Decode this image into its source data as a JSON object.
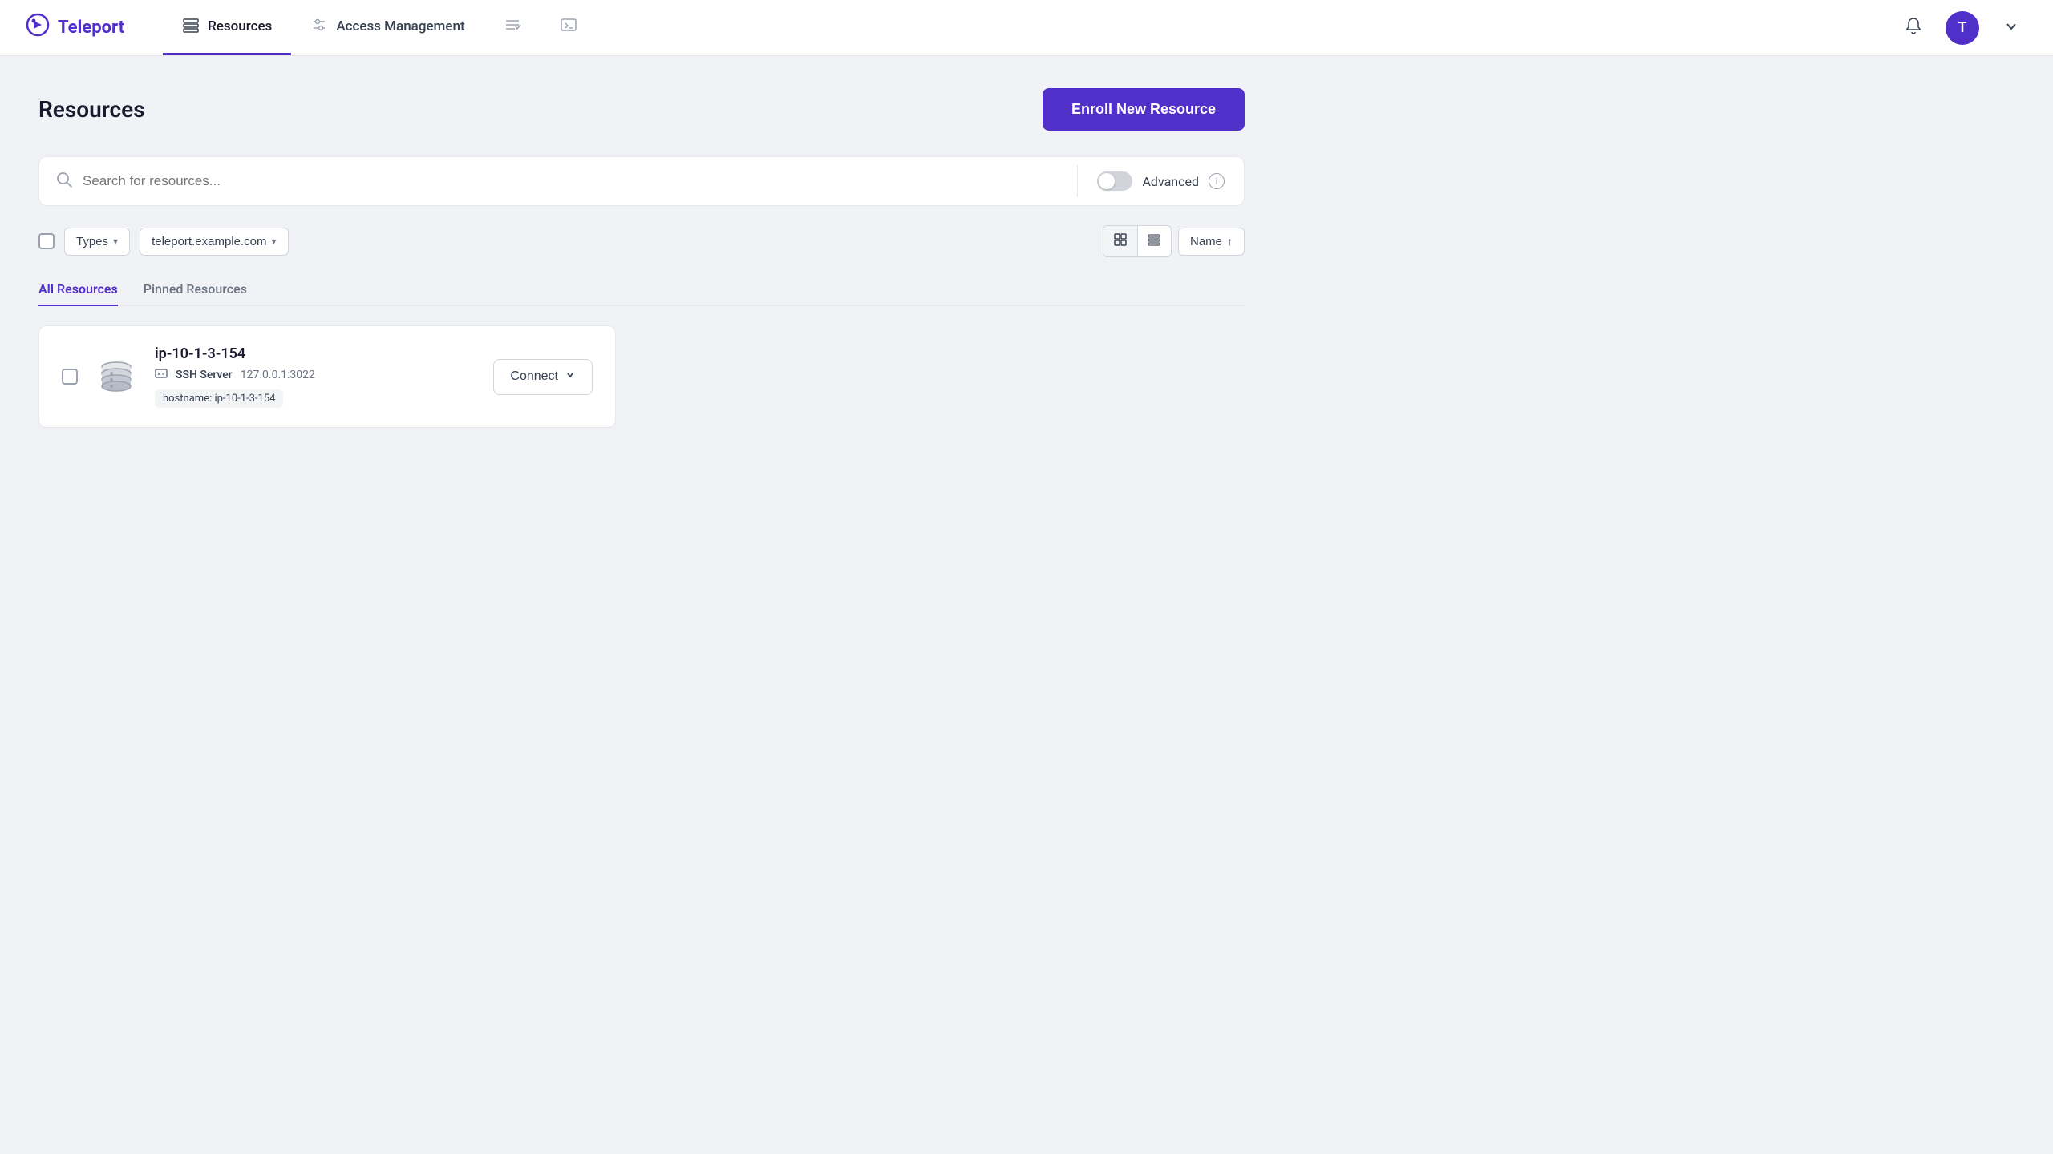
{
  "brand": {
    "name": "Teleport",
    "logo_icon": "⚙",
    "avatar_letter": "T"
  },
  "nav": {
    "items": [
      {
        "id": "resources",
        "label": "Resources",
        "active": true
      },
      {
        "id": "access-management",
        "label": "Access Management",
        "active": false
      }
    ],
    "icon_tasks": "tasks",
    "icon_terminal": "terminal",
    "icon_bell": "bell",
    "icon_chevron": "chevron-down"
  },
  "page": {
    "title": "Resources",
    "enroll_btn_label": "Enroll New Resource"
  },
  "search": {
    "placeholder": "Search for resources...",
    "advanced_label": "Advanced",
    "toggle_on": false
  },
  "filters": {
    "types_label": "Types",
    "cluster_label": "teleport.example.com",
    "sort_label": "Name"
  },
  "tabs": [
    {
      "id": "all",
      "label": "All Resources",
      "active": true
    },
    {
      "id": "pinned",
      "label": "Pinned Resources",
      "active": false
    }
  ],
  "resources": [
    {
      "id": "ip-10-1-3-154",
      "name": "ip-10-1-3-154",
      "type": "SSH Server",
      "address": "127.0.0.1:3022",
      "tags": [
        "hostname: ip-10-1-3-154"
      ],
      "connect_label": "Connect"
    }
  ]
}
